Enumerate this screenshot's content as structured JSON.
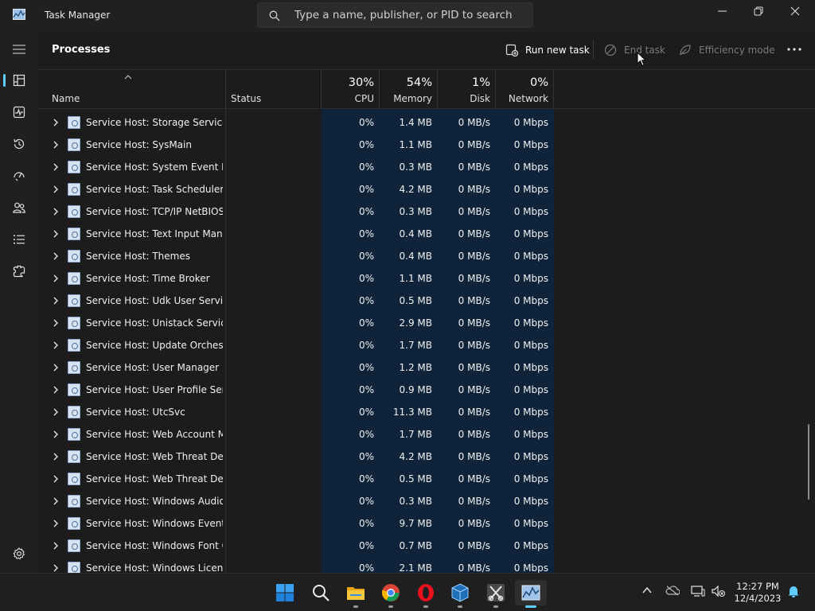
{
  "titlebar": {
    "title": "Task Manager",
    "search_placeholder": "Type a name, publisher, or PID to search",
    "icons": {
      "app": "task-manager-icon",
      "search": "search-icon",
      "minimize": "minimize-icon",
      "maximize": "restore-icon",
      "close": "close-icon"
    }
  },
  "nav": {
    "items": [
      {
        "name": "hamburger-menu",
        "icon": "hamburger-icon"
      },
      {
        "name": "processes",
        "icon": "processes-icon",
        "selected": true
      },
      {
        "name": "performance",
        "icon": "performance-icon"
      },
      {
        "name": "app-history",
        "icon": "history-icon"
      },
      {
        "name": "startup-apps",
        "icon": "startup-icon"
      },
      {
        "name": "users",
        "icon": "users-icon"
      },
      {
        "name": "details",
        "icon": "details-icon"
      },
      {
        "name": "services",
        "icon": "services-icon"
      },
      {
        "name": "settings",
        "icon": "settings-icon"
      }
    ],
    "accent": "#60cdff"
  },
  "page": {
    "title": "Processes",
    "commands": {
      "run_new_task": "Run new task",
      "end_task": "End task",
      "efficiency_mode": "Efficiency mode"
    }
  },
  "columns": {
    "name": "Name",
    "status": "Status",
    "cpu": {
      "pct": "30%",
      "label": "CPU"
    },
    "memory": {
      "pct": "54%",
      "label": "Memory"
    },
    "disk": {
      "pct": "1%",
      "label": "Disk"
    },
    "network": {
      "pct": "0%",
      "label": "Network"
    }
  },
  "processes": [
    {
      "name": "Service Host: Storage Service",
      "cpu": "0%",
      "memory": "1.4 MB",
      "disk": "0 MB/s",
      "network": "0 Mbps"
    },
    {
      "name": "Service Host: SysMain",
      "cpu": "0%",
      "memory": "1.1 MB",
      "disk": "0 MB/s",
      "network": "0 Mbps"
    },
    {
      "name": "Service Host: System Event No...",
      "cpu": "0%",
      "memory": "0.3 MB",
      "disk": "0 MB/s",
      "network": "0 Mbps"
    },
    {
      "name": "Service Host: Task Scheduler",
      "cpu": "0%",
      "memory": "4.2 MB",
      "disk": "0 MB/s",
      "network": "0 Mbps"
    },
    {
      "name": "Service Host: TCP/IP NetBIOS ...",
      "cpu": "0%",
      "memory": "0.3 MB",
      "disk": "0 MB/s",
      "network": "0 Mbps"
    },
    {
      "name": "Service Host: Text Input Mana...",
      "cpu": "0%",
      "memory": "0.4 MB",
      "disk": "0 MB/s",
      "network": "0 Mbps"
    },
    {
      "name": "Service Host: Themes",
      "cpu": "0%",
      "memory": "0.4 MB",
      "disk": "0 MB/s",
      "network": "0 Mbps"
    },
    {
      "name": "Service Host: Time Broker",
      "cpu": "0%",
      "memory": "1.1 MB",
      "disk": "0 MB/s",
      "network": "0 Mbps"
    },
    {
      "name": "Service Host: Udk User Service...",
      "cpu": "0%",
      "memory": "0.5 MB",
      "disk": "0 MB/s",
      "network": "0 Mbps"
    },
    {
      "name": "Service Host: Unistack Service ...",
      "cpu": "0%",
      "memory": "2.9 MB",
      "disk": "0 MB/s",
      "network": "0 Mbps"
    },
    {
      "name": "Service Host: Update Orchestr...",
      "cpu": "0%",
      "memory": "1.7 MB",
      "disk": "0 MB/s",
      "network": "0 Mbps"
    },
    {
      "name": "Service Host: User Manager",
      "cpu": "0%",
      "memory": "1.2 MB",
      "disk": "0 MB/s",
      "network": "0 Mbps"
    },
    {
      "name": "Service Host: User Profile Servi...",
      "cpu": "0%",
      "memory": "0.9 MB",
      "disk": "0 MB/s",
      "network": "0 Mbps"
    },
    {
      "name": "Service Host: UtcSvc",
      "cpu": "0%",
      "memory": "11.3 MB",
      "disk": "0 MB/s",
      "network": "0 Mbps"
    },
    {
      "name": "Service Host: Web Account M...",
      "cpu": "0%",
      "memory": "1.7 MB",
      "disk": "0 MB/s",
      "network": "0 Mbps"
    },
    {
      "name": "Service Host: Web Threat Defe...",
      "cpu": "0%",
      "memory": "4.2 MB",
      "disk": "0 MB/s",
      "network": "0 Mbps"
    },
    {
      "name": "Service Host: Web Threat Defe...",
      "cpu": "0%",
      "memory": "0.5 MB",
      "disk": "0 MB/s",
      "network": "0 Mbps"
    },
    {
      "name": "Service Host: Windows Audio ...",
      "cpu": "0%",
      "memory": "0.3 MB",
      "disk": "0 MB/s",
      "network": "0 Mbps"
    },
    {
      "name": "Service Host: Windows Event ...",
      "cpu": "0%",
      "memory": "9.7 MB",
      "disk": "0 MB/s",
      "network": "0 Mbps"
    },
    {
      "name": "Service Host: Windows Font C...",
      "cpu": "0%",
      "memory": "0.7 MB",
      "disk": "0 MB/s",
      "network": "0 Mbps"
    },
    {
      "name": "Service Host: Windows Licens...",
      "cpu": "0%",
      "memory": "2.1 MB",
      "disk": "0 MB/s",
      "network": "0 Mbps"
    }
  ],
  "taskbar": {
    "apps": [
      "start-button",
      "search-button",
      "file-explorer",
      "chrome",
      "opera",
      "virtualbox",
      "snipping-tool",
      "task-manager"
    ],
    "tray_icons": [
      "chevron-up-icon",
      "onedrive-icon",
      "network-icon",
      "volume-muted-icon",
      "notification-bell-icon"
    ],
    "time": "12:27 PM",
    "date": "12/4/2023"
  },
  "colors": {
    "background": "#1c1c1c",
    "chrome": "#202020",
    "metric_column": "#0f243a",
    "accent": "#60cdff"
  }
}
